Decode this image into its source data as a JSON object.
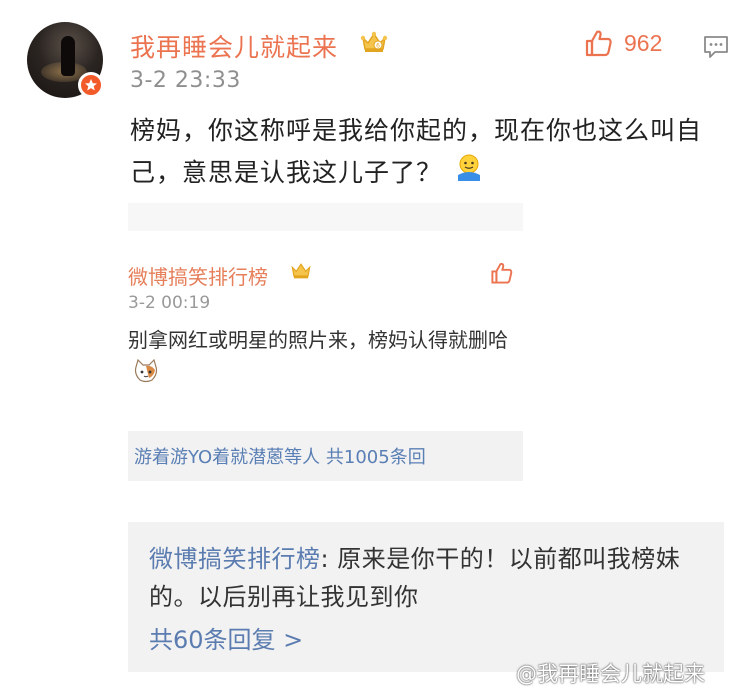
{
  "comment": {
    "username": "我再睡会儿就起来",
    "timestamp": "3-2 23:33",
    "like_count": "962",
    "content": "榜妈，你这称呼是我给你起的，现在你也这么叫自己，意思是认我这儿子了？"
  },
  "embedded_screenshot": {
    "username": "微博搞笑排行榜",
    "timestamp": "3-2 00:19",
    "content": "别拿网红或明星的照片来，榜妈认得就删哈",
    "reply_summary": "游着游YO着就潜蒽等人  共1005条回"
  },
  "reply": {
    "author": "微博搞笑排行榜",
    "separator": ":",
    "text": " 原来是你干的！以前都叫我榜妹的。以后别再让我见到你",
    "more_label": "共60条回复 >"
  },
  "watermark": "@我再睡会儿就起来",
  "colors": {
    "username": "#eb7350",
    "link": "#5b7cb0",
    "timestamp": "#8f8f8f",
    "reply_bg": "#f2f2f2"
  },
  "icons": [
    "avatar",
    "verified-badge-icon",
    "crown-vip-icon",
    "thumbs-up-icon",
    "comment-icon",
    "emoji-icon",
    "cat-emoji-icon"
  ]
}
